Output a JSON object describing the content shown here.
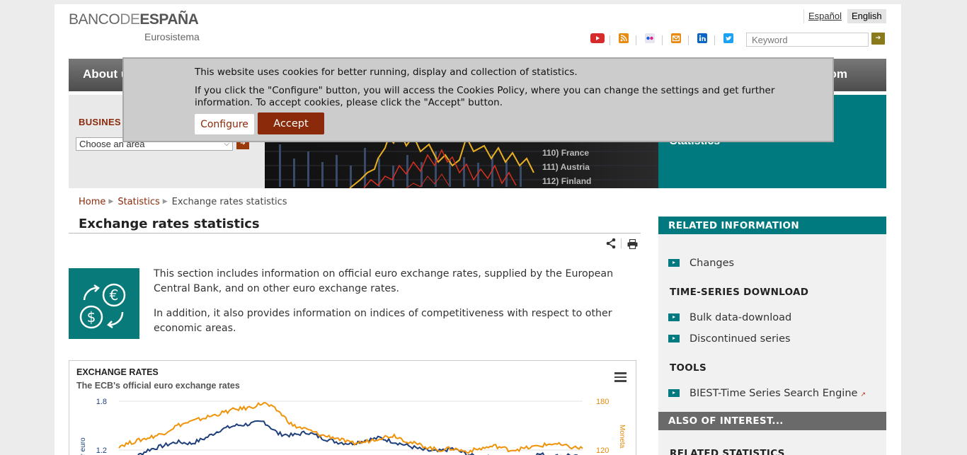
{
  "logo": {
    "main_a": "BANCO",
    "main_b": "DE",
    "main_c": "ESPAÑA",
    "sub": "Eurosistema"
  },
  "languages": {
    "es": "Español",
    "en": "English"
  },
  "search": {
    "placeholder": "Keyword"
  },
  "social_icons": [
    "youtube-icon",
    "rss-icon",
    "flickr-icon",
    "email-icon",
    "linkedin-icon",
    "twitter-icon"
  ],
  "nav": {
    "left_label": "About u",
    "right_label": "om"
  },
  "business": {
    "title": "BUSINES",
    "select_value": "Choose an area"
  },
  "banner": {
    "teal_text": "Statistics",
    "labels": [
      "110) France",
      "111) Austria",
      "112) Finland"
    ]
  },
  "breadcrumb": {
    "home": "Home",
    "statistics": "Statistics",
    "current": "Exchange rates statistics"
  },
  "page": {
    "title": "Exchange rates statistics",
    "intro1": "This section includes information on official euro exchange rates, supplied by the European Central Bank, and on other euro exchange rates.",
    "intro2": "In addition, it also provides information on indices of competitiveness with respect to other economic areas."
  },
  "chart_title": "EXCHANGE RATES",
  "chart_subtitle": "The ECB's official euro exchange rates",
  "chart_data": {
    "type": "line",
    "title": "EXCHANGE RATES",
    "subtitle": "The ECB's official euro exchange rates",
    "ylabel": "er euro",
    "y2label": "Moneta",
    "y_ticks": [
      "1.8",
      "1.2"
    ],
    "y2_ticks": [
      "180",
      "120"
    ],
    "series": [
      {
        "color": "#1f3f7a",
        "values": [
          1.05,
          1.1,
          1.2,
          1.25,
          1.3,
          1.28,
          1.35,
          1.45,
          1.5,
          1.52,
          1.55,
          1.4,
          1.38,
          1.42,
          1.35,
          1.3,
          1.28,
          1.32,
          1.35,
          1.3,
          1.25,
          1.2,
          1.18,
          1.22,
          1.15,
          1.1,
          1.12,
          1.08,
          1.1,
          1.15,
          1.12,
          1.14,
          1.1
        ]
      },
      {
        "color": "#f0930a",
        "values": [
          1.25,
          1.3,
          1.35,
          1.4,
          1.5,
          1.55,
          1.6,
          1.65,
          1.7,
          1.72,
          1.78,
          1.68,
          1.5,
          1.45,
          1.38,
          1.35,
          1.28,
          1.3,
          1.35,
          1.38,
          1.3,
          1.25,
          1.2,
          1.22,
          1.18,
          1.22,
          1.25,
          1.2,
          1.22,
          1.25,
          1.28,
          1.24,
          1.22
        ]
      }
    ],
    "colors": {
      "series1": "#1f3f7a",
      "series2": "#f0930a"
    }
  },
  "related": {
    "heading": "RELATED INFORMATION",
    "changes": "Changes",
    "ts_heading": "TIME-SERIES DOWNLOAD",
    "bulk": "Bulk data-download",
    "discontinued": "Discontinued series",
    "tools_heading": "TOOLS",
    "biest": "BIEST-Time Series Search Engine",
    "also_heading": "ALSO OF INTEREST...",
    "related_stats": "RELATED STATISTICS"
  },
  "cookie": {
    "line1": "This website uses cookies for better running, display and collection of statistics.",
    "line2": "If you click the \"Configure\" button, you will access the Cookies Policy, where you can change the settings and get further information. To accept cookies, please click the \"Accept\" button.",
    "configure": "Configure",
    "accept": "Accept"
  },
  "colors": {
    "teal": "#007a7e",
    "brand_red": "#8a2a0a",
    "gold": "#8a7a1b"
  }
}
